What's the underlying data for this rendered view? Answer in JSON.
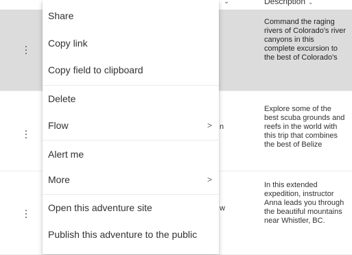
{
  "list": {
    "header": {
      "description_label": "Description",
      "sort_glyph": "⌄"
    },
    "rows": [
      {
        "description": "Command the raging\nrivers of Colorado's river\ncanyons in this\ncomplete excursion to\nthe best of Colorado's",
        "peek_text": "",
        "selected": true
      },
      {
        "description": "Explore some of the\nbest scuba grounds and\nreefs in the world with\nthis trip that combines\nthe best of Belize",
        "peek_text": "n",
        "selected": false
      },
      {
        "description": "In this extended\nexpedition, instructor\nAnna leads you through\nthe beautiful mountains\nnear Whistler, BC.",
        "peek_text": "w",
        "selected": false
      }
    ]
  },
  "context_menu": {
    "items": [
      {
        "label": "Share",
        "has_submenu": false
      },
      {
        "label": "Copy link",
        "has_submenu": false
      },
      {
        "label": "Copy field to clipboard",
        "has_submenu": false
      },
      {
        "label": "Delete",
        "has_submenu": false
      },
      {
        "label": "Flow",
        "has_submenu": true
      },
      {
        "label": "Alert me",
        "has_submenu": false
      },
      {
        "label": "More",
        "has_submenu": true
      },
      {
        "label": "Open this adventure site",
        "has_submenu": false
      },
      {
        "label": "Publish this adventure to the public",
        "has_submenu": false
      }
    ],
    "submenu_chevron": ">"
  },
  "colors": {
    "selected_row": "#dcdcdc",
    "menu_background": "#ffffff",
    "text": "#323130",
    "divider": "#edebe9"
  }
}
